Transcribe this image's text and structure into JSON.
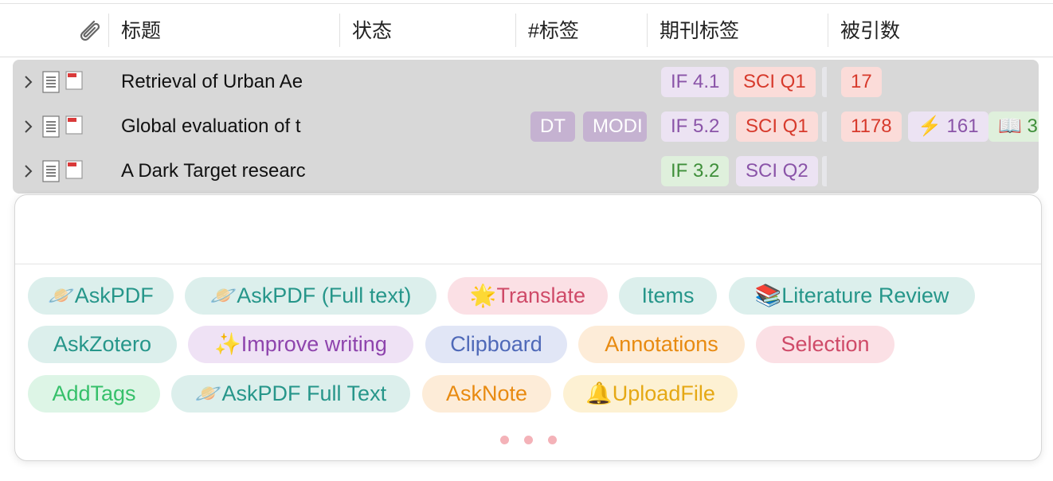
{
  "header": {
    "attachment_icon": "paperclip-icon",
    "columns": [
      "标题",
      "状态",
      "#标签",
      "期刊标签",
      "被引数"
    ]
  },
  "rows": [
    {
      "title": "Retrieval of Urban Ae",
      "tags": [],
      "journal": [
        {
          "text": "IF 4.1",
          "bg": "#ece3f3",
          "fg": "#8a54a8"
        },
        {
          "text": "SCI Q1",
          "bg": "#fbdcd9",
          "fg": "#d73a2c"
        }
      ],
      "cites": [
        {
          "text": "17",
          "bg": "#fbdcd9",
          "fg": "#d73a2c"
        }
      ]
    },
    {
      "title": "Global evaluation of t",
      "tags": [
        {
          "text": "DT",
          "bg": "#c5b2d1",
          "fg": "#ffffff"
        },
        {
          "text": "MODI",
          "bg": "#c5b2d1",
          "fg": "#ffffff"
        }
      ],
      "journal": [
        {
          "text": "IF 5.2",
          "bg": "#ece3f3",
          "fg": "#8a54a8"
        },
        {
          "text": "SCI Q1",
          "bg": "#fbdcd9",
          "fg": "#d73a2c"
        }
      ],
      "cites": [
        {
          "text": "1178",
          "bg": "#fbdcd9",
          "fg": "#d73a2c"
        },
        {
          "text": "⚡ 161",
          "bg": "#ece3f3",
          "fg": "#8a54a8"
        },
        {
          "text": "📖 3",
          "bg": "#dff0dc",
          "fg": "#3f8f3a"
        }
      ]
    },
    {
      "title": "A Dark Target researc",
      "tags": [],
      "journal": [
        {
          "text": "IF 3.2",
          "bg": "#dff0dc",
          "fg": "#3f8f3a"
        },
        {
          "text": "SCI Q2",
          "bg": "#ece3f3",
          "fg": "#8a54a8"
        }
      ],
      "cites": []
    }
  ],
  "panel": {
    "input_value": "",
    "chips": [
      {
        "text": "🪐AskPDF",
        "bg": "#dcefec",
        "fg": "#26968a"
      },
      {
        "text": "🪐AskPDF (Full text)",
        "bg": "#dcefec",
        "fg": "#26968a"
      },
      {
        "text": "🌟Translate",
        "bg": "#fbe0e5",
        "fg": "#cf4a68"
      },
      {
        "text": "Items",
        "bg": "#dcefec",
        "fg": "#26968a"
      },
      {
        "text": "📚Literature Review",
        "bg": "#dcefec",
        "fg": "#26968a"
      },
      {
        "text": "AskZotero",
        "bg": "#dcefec",
        "fg": "#26968a"
      },
      {
        "text": "✨Improve writing",
        "bg": "#efe2f5",
        "fg": "#8e44ad"
      },
      {
        "text": "Clipboard",
        "bg": "#e1e6f6",
        "fg": "#4f69b8"
      },
      {
        "text": "Annotations",
        "bg": "#fdecd8",
        "fg": "#e88a10"
      },
      {
        "text": "Selection",
        "bg": "#fbe0e5",
        "fg": "#cf4a68"
      },
      {
        "text": "AddTags",
        "bg": "#ddf5e6",
        "fg": "#36c06a"
      },
      {
        "text": "🪐AskPDF Full Text",
        "bg": "#dcefec",
        "fg": "#26968a"
      },
      {
        "text": "AskNote",
        "bg": "#fdecd8",
        "fg": "#e88a10"
      },
      {
        "text": "🔔UploadFile",
        "bg": "#fdf1d3",
        "fg": "#e5a814"
      }
    ],
    "pager_dots": 3
  }
}
